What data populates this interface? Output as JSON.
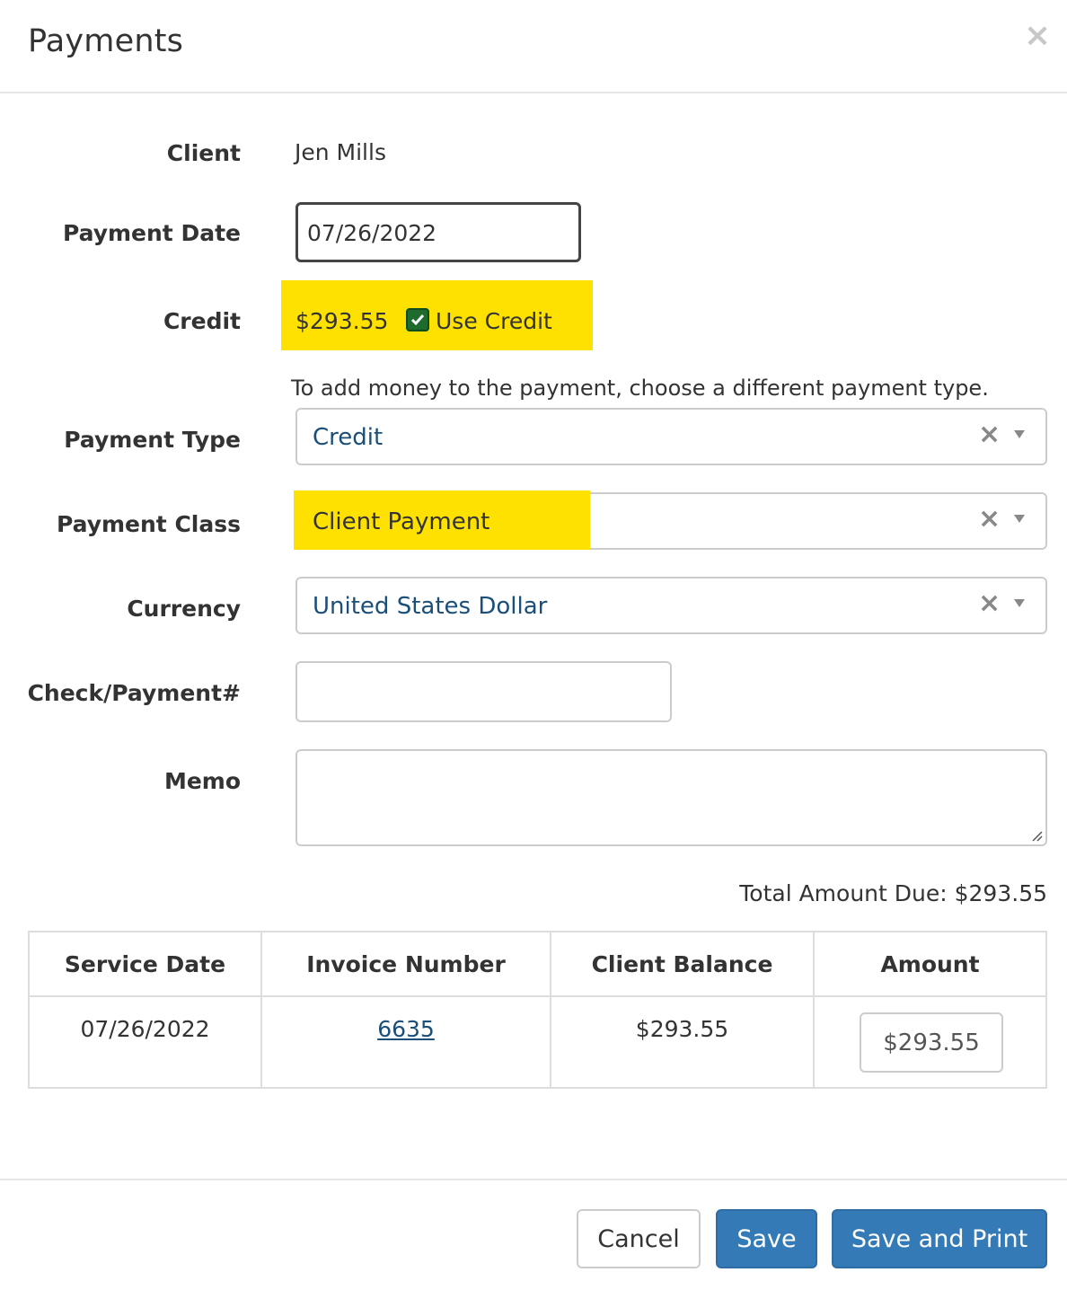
{
  "modal": {
    "title": "Payments",
    "close_glyph": "×"
  },
  "form": {
    "client": {
      "label": "Client",
      "value": "Jen Mills"
    },
    "payment_date": {
      "label": "Payment Date",
      "value": "07/26/2022"
    },
    "credit": {
      "label": "Credit",
      "amount": "$293.55",
      "use_credit_label": "Use Credit",
      "use_credit_checked": true
    },
    "hint": "To add money to the payment, choose a different payment type.",
    "payment_type": {
      "label": "Payment Type",
      "value": "Credit",
      "clear_glyph": "×"
    },
    "payment_class": {
      "label": "Payment Class",
      "value": "Client Payment",
      "clear_glyph": "×"
    },
    "currency": {
      "label": "Currency",
      "value": "United States Dollar",
      "clear_glyph": "×"
    },
    "check_payment": {
      "label": "Check/Payment#",
      "value": ""
    },
    "memo": {
      "label": "Memo",
      "value": ""
    }
  },
  "total": "Total Amount Due: $293.55",
  "table": {
    "headers": [
      "Service Date",
      "Invoice Number",
      "Client Balance",
      "Amount"
    ],
    "rows": [
      {
        "service_date": "07/26/2022",
        "invoice_number": "6635",
        "client_balance": "$293.55",
        "amount": "$293.55"
      }
    ]
  },
  "footer": {
    "cancel_label": "Cancel",
    "save_label": "Save",
    "save_print_label": "Save and Print"
  },
  "colors": {
    "highlight": "#ffe100",
    "primary_button": "#337ab7",
    "link": "#1a4f7a",
    "checkbox": "#1e6b2e"
  }
}
